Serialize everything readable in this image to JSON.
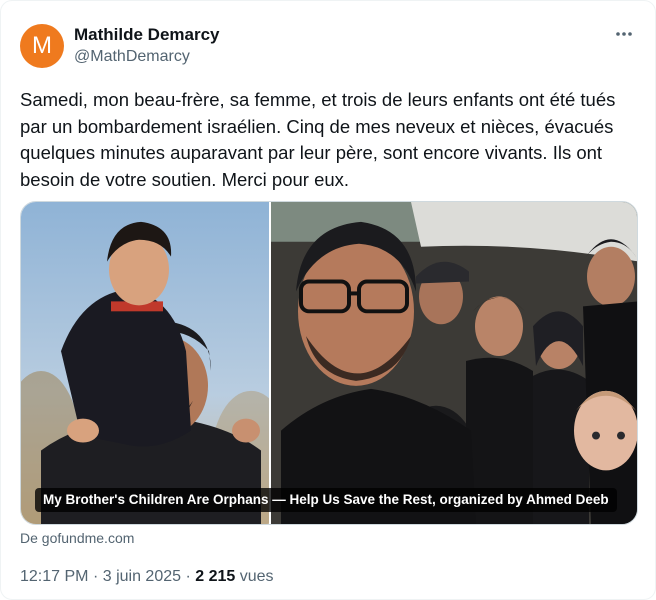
{
  "author": {
    "name": "Mathilde Demarcy",
    "handle": "@MathDemarcy",
    "avatar_letter": "M",
    "avatar_color": "#ef7a1e"
  },
  "more_icon": "more-horizontal-icon",
  "tweet_lines": [
    "Samedi, mon beau-frère, sa femme, et trois de leurs enfants ont été tués",
    "par un bombardement israélien. Cinq de mes neveux et nièces, évacués",
    "quelques minutes auparavant par leur père, sont encore vivants. Ils ont",
    "besoin de votre soutien. Merci pour eux."
  ],
  "link_card": {
    "title": "My Brother's Children Are Orphans — Help Us Save the Rest, organized by Ahmed Deeb",
    "source": "De gofundme.com"
  },
  "meta": {
    "time": "12:17 PM",
    "separator": "·",
    "date": "3 juin 2025",
    "views_count": "2 215",
    "views_label": "vues"
  },
  "colors": {
    "text": "#0f1419",
    "secondary": "#536471"
  }
}
